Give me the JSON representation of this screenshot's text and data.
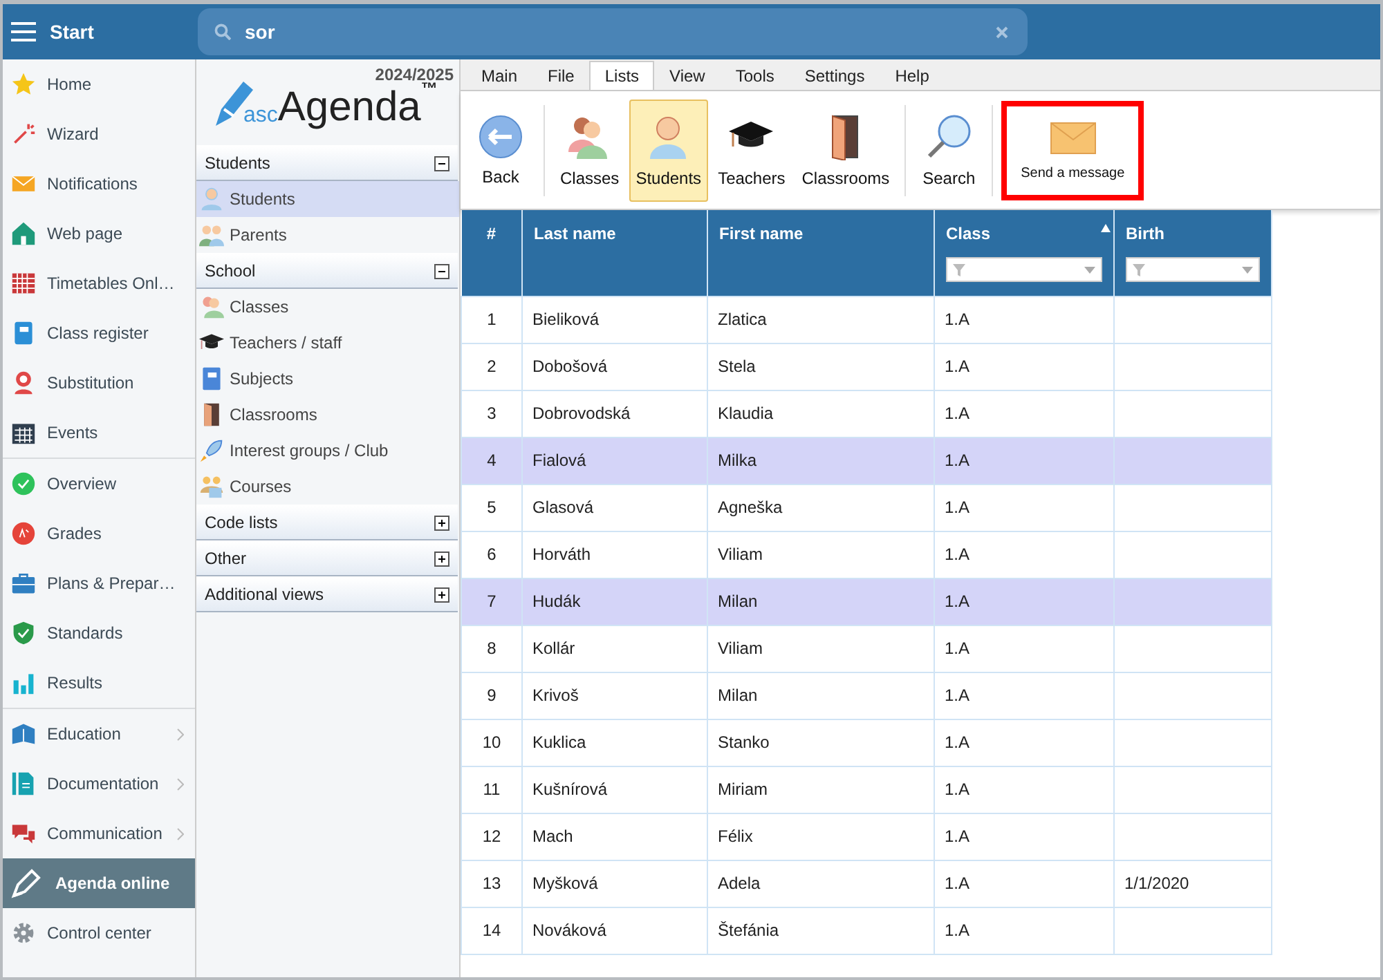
{
  "topbar": {
    "title": "Start",
    "search": {
      "value": "sor"
    }
  },
  "sidebar": {
    "groups": [
      [
        {
          "label": "Home",
          "selected": false
        },
        {
          "label": "Wizard",
          "selected": false
        },
        {
          "label": "Notifications",
          "selected": false
        },
        {
          "label": "Web page",
          "selected": false
        },
        {
          "label": "Timetables Onl…",
          "selected": false
        },
        {
          "label": "Class register",
          "selected": false
        },
        {
          "label": "Substitution",
          "selected": false
        },
        {
          "label": "Events",
          "selected": false
        }
      ],
      [
        {
          "label": "Overview",
          "selected": false
        },
        {
          "label": "Grades",
          "selected": false
        },
        {
          "label": "Plans & Prepar…",
          "selected": false
        },
        {
          "label": "Standards",
          "selected": false
        },
        {
          "label": "Results",
          "selected": false
        }
      ],
      [
        {
          "label": "Education",
          "selected": false,
          "submenu": true
        },
        {
          "label": "Documentation",
          "selected": false,
          "submenu": true
        },
        {
          "label": "Communication",
          "selected": false,
          "submenu": true
        },
        {
          "label": "Agenda online",
          "selected": true
        },
        {
          "label": "Control center",
          "selected": false
        }
      ]
    ]
  },
  "panel": {
    "year": "2024/2025",
    "logo": {
      "prefix": "asc",
      "name": "Agenda",
      "mark": "™"
    },
    "sections": [
      {
        "title": "Students",
        "expanded": true,
        "items": [
          {
            "label": "Students",
            "selected": true
          },
          {
            "label": "Parents",
            "selected": false
          }
        ]
      },
      {
        "title": "School",
        "expanded": true,
        "items": [
          {
            "label": "Classes",
            "selected": false
          },
          {
            "label": "Teachers / staff",
            "selected": false
          },
          {
            "label": "Subjects",
            "selected": false
          },
          {
            "label": "Classrooms",
            "selected": false
          },
          {
            "label": "Interest groups / Club",
            "selected": false
          },
          {
            "label": "Courses",
            "selected": false
          }
        ]
      },
      {
        "title": "Code lists",
        "expanded": false
      },
      {
        "title": "Other",
        "expanded": false
      },
      {
        "title": "Additional views",
        "expanded": false
      }
    ]
  },
  "ribbon": {
    "tabs": [
      {
        "label": "Main",
        "selected": false
      },
      {
        "label": "File",
        "selected": false
      },
      {
        "label": "Lists",
        "selected": true
      },
      {
        "label": "View",
        "selected": false
      },
      {
        "label": "Tools",
        "selected": false
      },
      {
        "label": "Settings",
        "selected": false
      },
      {
        "label": "Help",
        "selected": false
      }
    ],
    "buttons": [
      {
        "label": "Back",
        "selected": false,
        "highlighted": false
      },
      {
        "label": "Classes",
        "selected": false,
        "highlighted": false
      },
      {
        "label": "Students",
        "selected": true,
        "highlighted": false
      },
      {
        "label": "Teachers",
        "selected": false,
        "highlighted": false
      },
      {
        "label": "Classrooms",
        "selected": false,
        "highlighted": false
      },
      {
        "label": "Search",
        "selected": false,
        "highlighted": false
      },
      {
        "label": "Send a message",
        "selected": false,
        "highlighted": true
      }
    ]
  },
  "table": {
    "columns": [
      {
        "label": "#",
        "sorted": false,
        "filter": false
      },
      {
        "label": "Last name",
        "sorted": false,
        "filter": false
      },
      {
        "label": "First name",
        "sorted": false,
        "filter": false
      },
      {
        "label": "Class",
        "sorted": true,
        "filter": true
      },
      {
        "label": "Birth",
        "sorted": false,
        "filter": true
      }
    ],
    "rows": [
      {
        "cells": [
          "1",
          "Bieliková",
          "Zlatica",
          "1.A",
          ""
        ],
        "selected": false
      },
      {
        "cells": [
          "2",
          "Dobošová",
          "Stela",
          "1.A",
          ""
        ],
        "selected": false
      },
      {
        "cells": [
          "3",
          "Dobrovodská",
          "Klaudia",
          "1.A",
          ""
        ],
        "selected": false
      },
      {
        "cells": [
          "4",
          "Fialová",
          "Milka",
          "1.A",
          ""
        ],
        "selected": true
      },
      {
        "cells": [
          "5",
          "Glasová",
          "Agneška",
          "1.A",
          ""
        ],
        "selected": false
      },
      {
        "cells": [
          "6",
          "Horváth",
          "Viliam",
          "1.A",
          ""
        ],
        "selected": false
      },
      {
        "cells": [
          "7",
          "Hudák",
          "Milan",
          "1.A",
          ""
        ],
        "selected": true
      },
      {
        "cells": [
          "8",
          "Kollár",
          "Viliam",
          "1.A",
          ""
        ],
        "selected": false
      },
      {
        "cells": [
          "9",
          "Krivoš",
          "Milan",
          "1.A",
          ""
        ],
        "selected": false
      },
      {
        "cells": [
          "10",
          "Kuklica",
          "Stanko",
          "1.A",
          ""
        ],
        "selected": false
      },
      {
        "cells": [
          "11",
          "Kušnírová",
          "Miriam",
          "1.A",
          ""
        ],
        "selected": false
      },
      {
        "cells": [
          "12",
          "Mach",
          "Félix",
          "1.A",
          ""
        ],
        "selected": false
      },
      {
        "cells": [
          "13",
          "Myšková",
          "Adela",
          "1.A",
          "1/1/2020"
        ],
        "selected": false
      },
      {
        "cells": [
          "14",
          "Nováková",
          "Štefánia",
          "1.A",
          ""
        ],
        "selected": false
      }
    ]
  }
}
